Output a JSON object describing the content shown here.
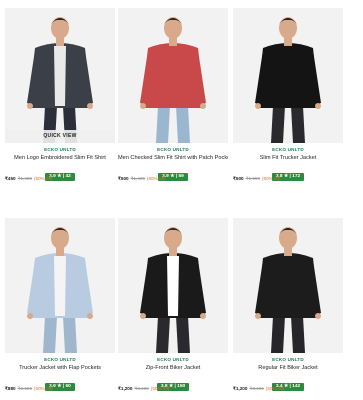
{
  "quick_view_label": "QUICK VIEW",
  "products": [
    {
      "brand": "ECKO UNLTD",
      "title": "Men Logo Embroidered Slim Fit Shirt",
      "rating": "3.9 ★ | 42",
      "price": "₹450",
      "mrp": "₹1,499",
      "discount": "(50% off)",
      "colors": {
        "bg": "#f2f2f2",
        "garment": "#3b3f48",
        "inner": "#e9e9e9",
        "pants": "#2b2f3a",
        "skin": "#d8a98a",
        "hair": "#2a1f1a"
      }
    },
    {
      "brand": "ECKO UNLTD",
      "title": "Men Checked Slim Fit Shirt with Patch Pocket",
      "rating": "3.9 ★ | 59",
      "price": "₹500",
      "mrp": "₹1,499",
      "discount": "(66% off)",
      "colors": {
        "bg": "#f2f2f2",
        "garment": "#c9484a",
        "inner": "#c9484a",
        "pants": "#9bb6cf",
        "skin": "#d8a98a",
        "hair": "#2a1f1a"
      }
    },
    {
      "brand": "ECKO UNLTD",
      "title": "Slim Fit Trucker Jacket",
      "rating": "3.8 ★ | 172",
      "price": "₹500",
      "mrp": "₹1,999",
      "discount": "(60% off)",
      "colors": {
        "bg": "#f2f2f2",
        "garment": "#141414",
        "inner": "#141414",
        "pants": "#2a2a2e",
        "skin": "#d8a98a",
        "hair": "#1f1916"
      }
    },
    {
      "brand": "ECKO UNLTD",
      "title": "Trucker Jacket with Flap Pockets",
      "rating": "3.9 ★ | 50",
      "price": "₹880",
      "mrp": "₹2,699",
      "discount": "(60% off)",
      "colors": {
        "bg": "#f2f2f2",
        "garment": "#b9cbe0",
        "inner": "#f4f4f4",
        "pants": "#9fb6cc",
        "skin": "#d8a98a",
        "hair": "#2a1f1a"
      }
    },
    {
      "brand": "ECKO UNLTD",
      "title": "Zip-Front Biker Jacket",
      "rating": "3.8 ★ | 150",
      "price": "₹1,200",
      "mrp": "₹3,499",
      "discount": "(50% off)",
      "colors": {
        "bg": "#f2f2f2",
        "garment": "#1a1a1a",
        "inner": "#ffffff",
        "pants": "#2a2a2e",
        "skin": "#d8a98a",
        "hair": "#2a1f1a"
      }
    },
    {
      "brand": "ECKO UNLTD",
      "title": "Regular Fit Biker Jacket",
      "rating": "3.4 ★ | 142",
      "price": "₹1,200",
      "mrp": "₹3,499",
      "discount": "(50% off)",
      "colors": {
        "bg": "#f2f2f2",
        "garment": "#1c1c1c",
        "inner": "#1c1c1c",
        "pants": "#26262a",
        "skin": "#d8a98a",
        "hair": "#1f1916"
      }
    }
  ]
}
